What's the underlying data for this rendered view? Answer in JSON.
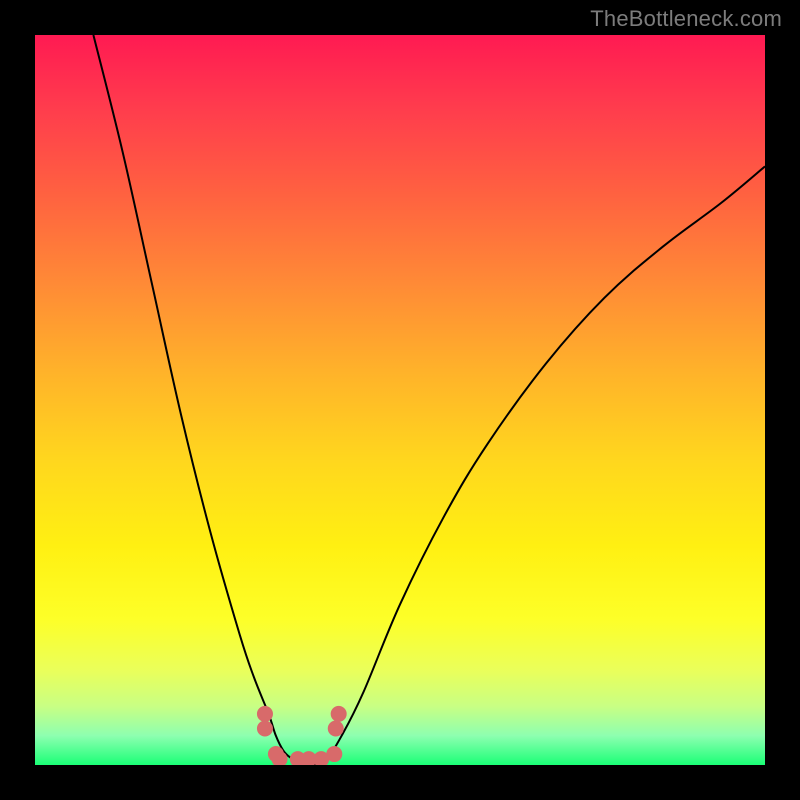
{
  "watermark": "TheBottleneck.com",
  "chart_data": {
    "type": "line",
    "title": "",
    "xlabel": "",
    "ylabel": "",
    "xlim": [
      0,
      100
    ],
    "ylim": [
      0,
      100
    ],
    "grid": false,
    "legend": false,
    "series": [
      {
        "name": "left-curve",
        "x": [
          8,
          12,
          16,
          20,
          24,
          28,
          30,
          32,
          33,
          34,
          35,
          36,
          38
        ],
        "y": [
          100,
          84,
          66,
          48,
          32,
          18,
          12,
          7,
          4,
          2,
          1,
          0.5,
          0
        ]
      },
      {
        "name": "right-curve",
        "x": [
          38,
          40,
          42,
          45,
          50,
          56,
          62,
          70,
          78,
          86,
          94,
          100
        ],
        "y": [
          0,
          1,
          4,
          10,
          22,
          34,
          44,
          55,
          64,
          71,
          77,
          82
        ]
      },
      {
        "name": "valley-markers",
        "x": [
          31.5,
          31.5,
          33.0,
          33.5,
          36.0,
          37.5,
          39.2,
          41.0,
          41.2,
          41.6
        ],
        "y": [
          7.0,
          5.0,
          1.5,
          0.8,
          0.8,
          0.8,
          0.8,
          1.5,
          5.0,
          7.0
        ]
      }
    ],
    "gradient_stops": [
      {
        "pos": 0,
        "color": "#ff1a52"
      },
      {
        "pos": 10,
        "color": "#ff3c4d"
      },
      {
        "pos": 22,
        "color": "#ff6240"
      },
      {
        "pos": 34,
        "color": "#ff8a36"
      },
      {
        "pos": 46,
        "color": "#ffb22a"
      },
      {
        "pos": 58,
        "color": "#ffd61e"
      },
      {
        "pos": 70,
        "color": "#fff012"
      },
      {
        "pos": 80,
        "color": "#fdff28"
      },
      {
        "pos": 87,
        "color": "#eaff5a"
      },
      {
        "pos": 92,
        "color": "#c8ff84"
      },
      {
        "pos": 96,
        "color": "#8dffb0"
      },
      {
        "pos": 100,
        "color": "#1aff76"
      }
    ],
    "marker_color": "#d86a6a",
    "curve_color": "#000000"
  }
}
